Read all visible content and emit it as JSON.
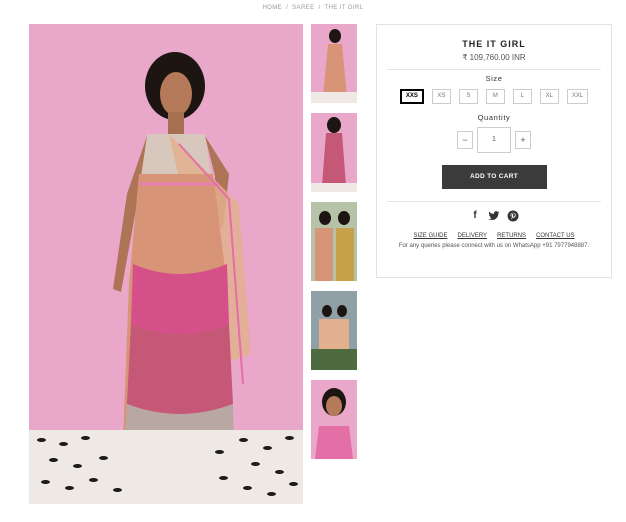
{
  "breadcrumb": {
    "home": "HOME",
    "sep": "/",
    "category": "SAREE",
    "current": "THE IT GIRL"
  },
  "product": {
    "title": "THE IT GIRL",
    "price": "₹ 109,760.00 INR",
    "size_label": "Size",
    "sizes": [
      "XXS",
      "XS",
      "S",
      "M",
      "L",
      "XL",
      "XXL"
    ],
    "selected_size": "XXS",
    "quantity_label": "Quantity",
    "quantity": "1",
    "minus": "−",
    "plus": "+",
    "add_to_cart": "ADD TO CART",
    "links": {
      "size_guide": "SIZE GUIDE",
      "delivery": "DELIVERY",
      "returns": "RETURNS",
      "contact": "CONTACT US"
    },
    "note": "For any queries please connect with us on WhatsApp +91 7977948887."
  },
  "social": [
    "facebook-icon",
    "twitter-icon",
    "pinterest-icon"
  ],
  "colors": {
    "backdrop_pink": "#e9a7c9",
    "button_dark": "#3b3b3b"
  }
}
